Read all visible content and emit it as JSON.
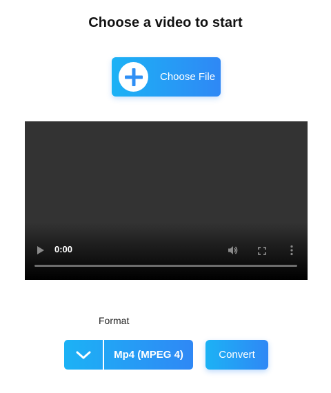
{
  "page": {
    "title": "Choose a video to start"
  },
  "upload": {
    "button_label": "Choose File",
    "icon": "plus-circle-icon"
  },
  "video_player": {
    "current_time": "0:00",
    "controls": [
      "play-icon",
      "volume-icon",
      "fullscreen-icon",
      "more-options-icon"
    ]
  },
  "format": {
    "label": "Format",
    "selected": "Mp4 (MPEG 4)",
    "icon": "chevron-down-icon"
  },
  "actions": {
    "convert_label": "Convert"
  },
  "colors": {
    "accent_start": "#1cb2f5",
    "accent_end": "#2f88f5",
    "video_background": "#333333"
  }
}
